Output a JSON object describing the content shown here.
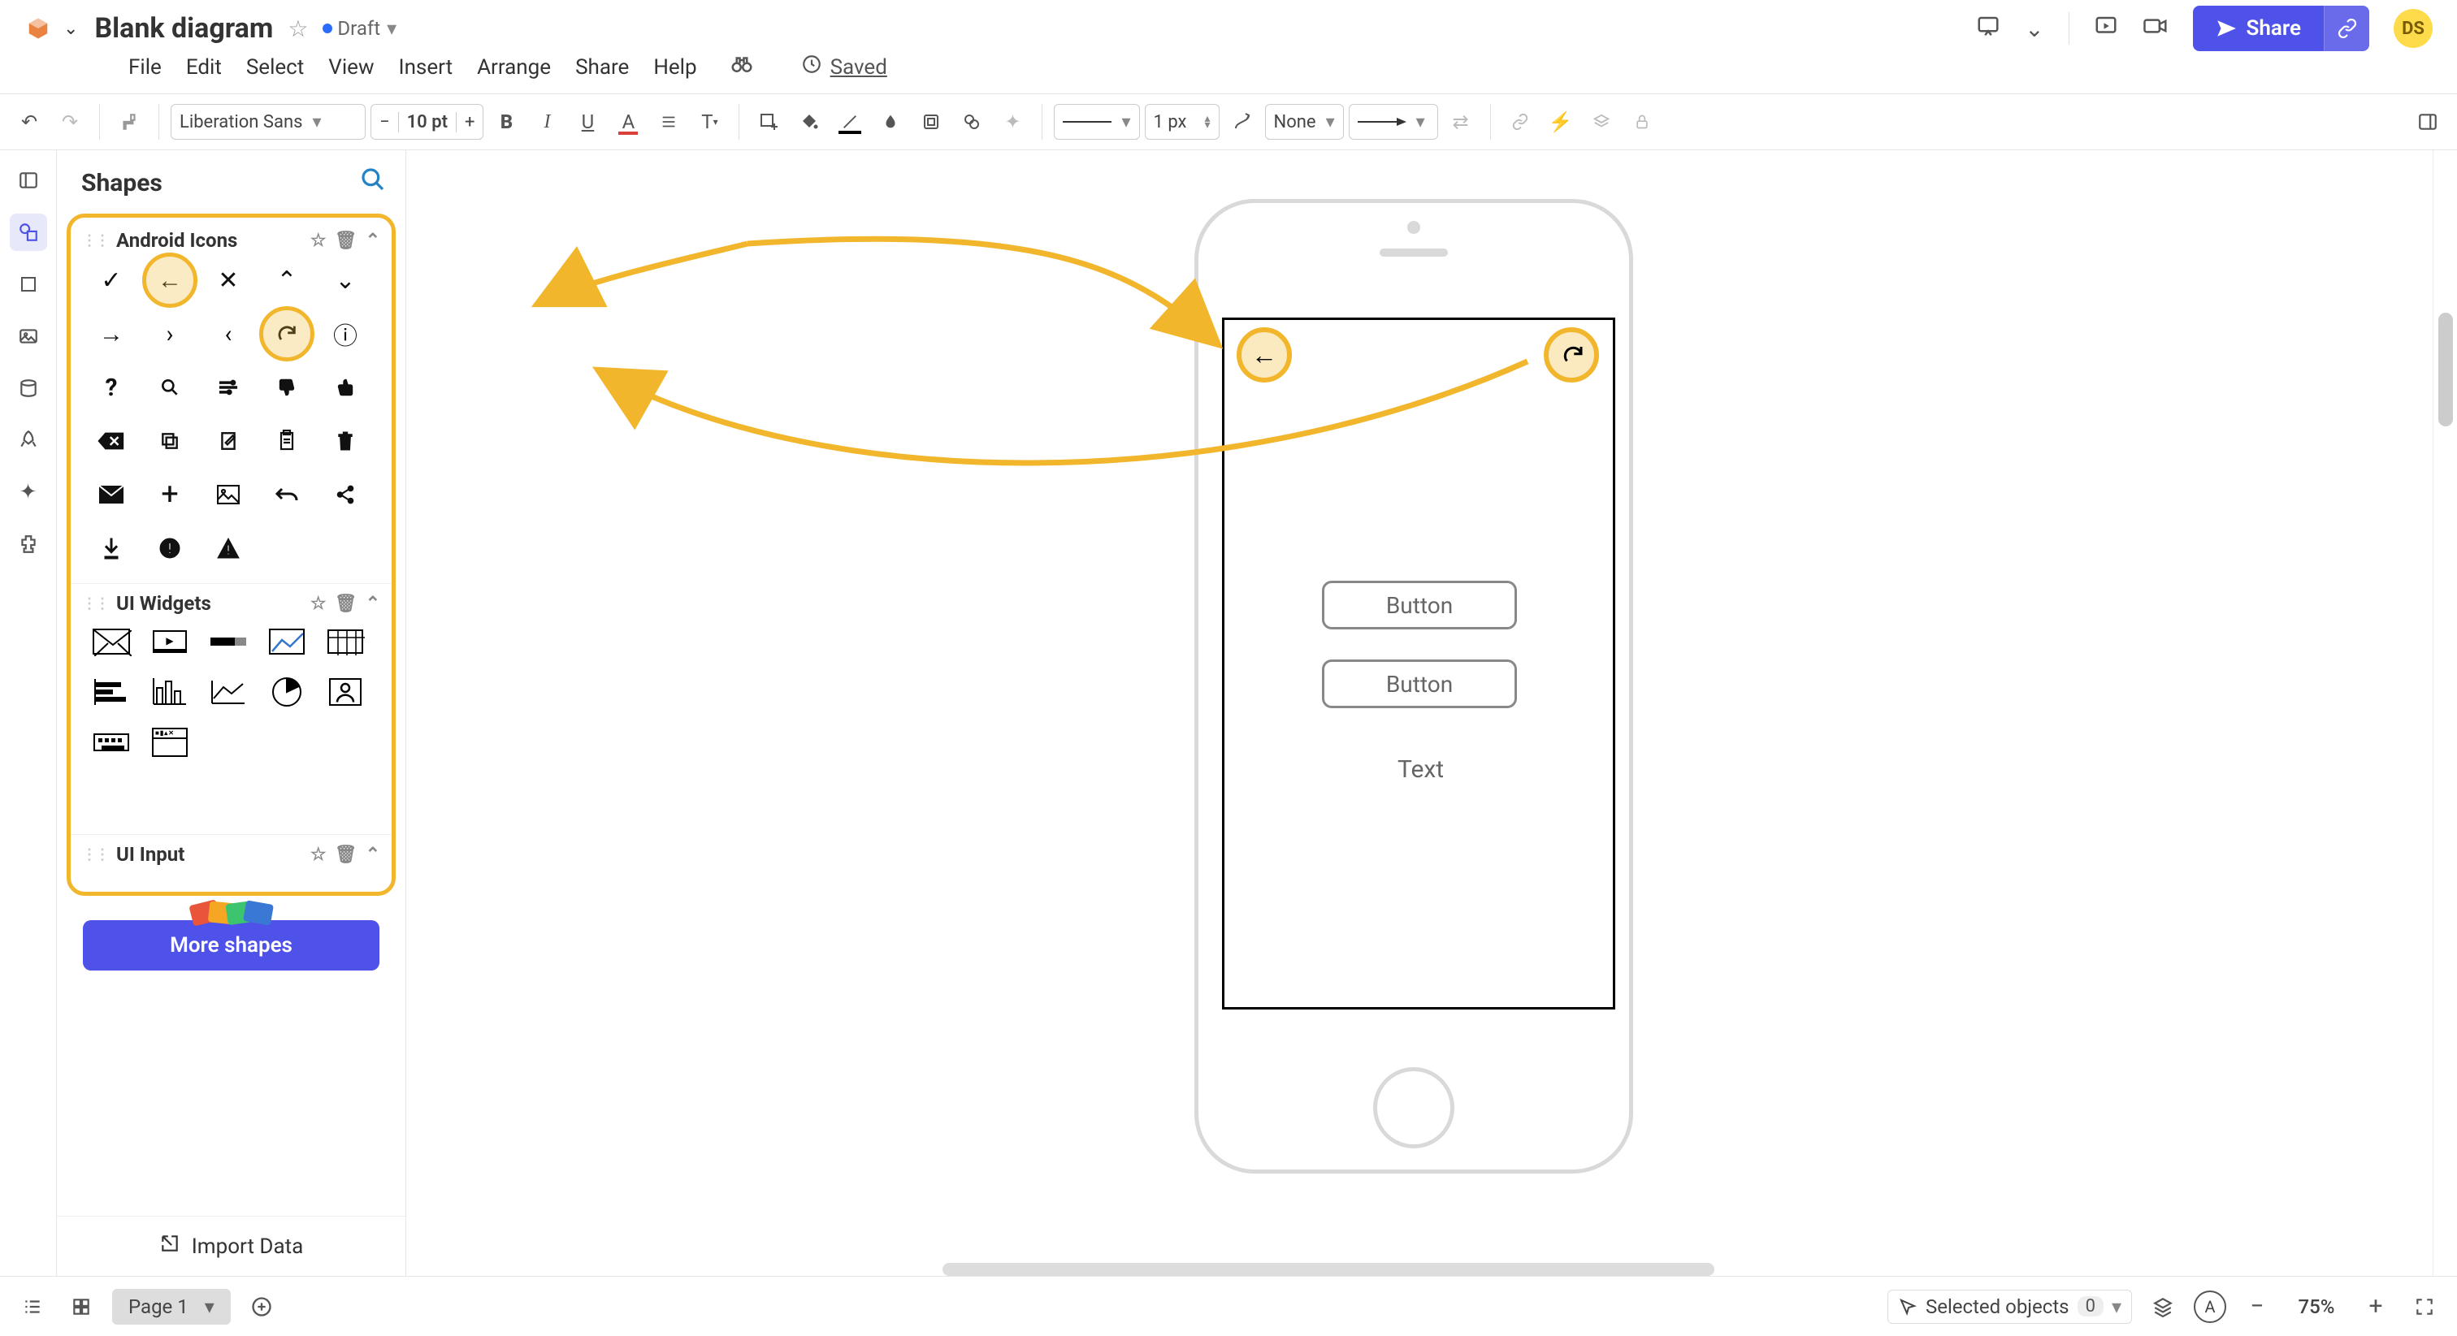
{
  "doc": {
    "title": "Blank diagram",
    "status": "Draft",
    "saved": "Saved"
  },
  "menu": {
    "file": "File",
    "edit": "Edit",
    "select": "Select",
    "view": "View",
    "insert": "Insert",
    "arrange": "Arrange",
    "share": "Share",
    "help": "Help"
  },
  "header": {
    "share_btn": "Share",
    "avatar": "DS"
  },
  "toolbar": {
    "font": "Liberation Sans",
    "font_size": "10 pt",
    "line_width": "1 px",
    "fill_label": "None"
  },
  "sidebar": {
    "title": "Shapes",
    "groups": {
      "android": "Android Icons",
      "widgets": "UI Widgets",
      "input": "UI Input"
    },
    "more_shapes": "More shapes",
    "import": "Import Data"
  },
  "canvas": {
    "button_label": "Button",
    "text_label": "Text"
  },
  "statusbar": {
    "page": "Page 1",
    "selected": "Selected objects",
    "selected_count": "0",
    "zoom": "75%"
  }
}
